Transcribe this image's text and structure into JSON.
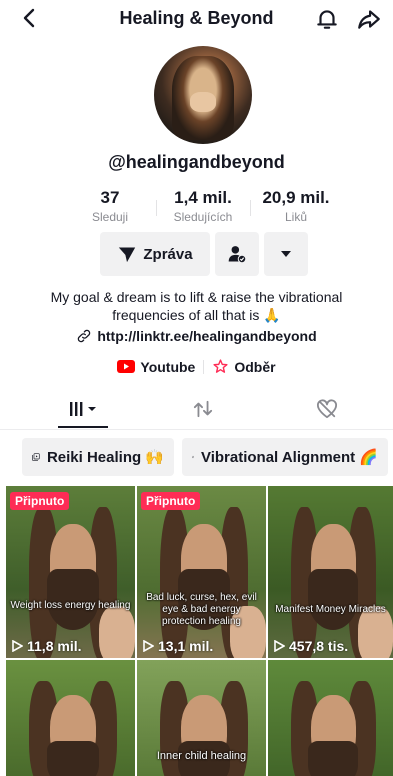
{
  "header": {
    "title": "Healing & Beyond"
  },
  "profile": {
    "handle": "@healingandbeyond",
    "stats": [
      {
        "value": "37",
        "label": "Sleduji"
      },
      {
        "value": "1,4 mil.",
        "label": "Sledujících"
      },
      {
        "value": "20,9 mil.",
        "label": "Liků"
      }
    ],
    "message_button": "Zpráva",
    "bio": "My goal & dream is to lift & raise the vibrational frequencies of all that is 🙏",
    "link": "http://linktr.ee/healingandbeyond",
    "socials": [
      {
        "label": "Youtube",
        "icon": "youtube-icon"
      },
      {
        "label": "Odběr",
        "icon": "subscription-icon"
      }
    ]
  },
  "tabs": [
    {
      "name": "videos",
      "icon": "grid-icon",
      "selected": true
    },
    {
      "name": "reposts",
      "icon": "repost-icon"
    },
    {
      "name": "liked",
      "icon": "liked-hidden-icon"
    }
  ],
  "playlists": [
    {
      "label": "Reiki Healing 🙌"
    },
    {
      "label": "Vibrational Alignment 🌈"
    }
  ],
  "videos": [
    {
      "pinned_label": "Připnuto",
      "caption": "Weight loss energy healing",
      "views": "11,8 mil."
    },
    {
      "pinned_label": "Připnuto",
      "caption": "Bad luck, curse, hex, evil eye & bad energy protection healing",
      "views": "13,1 mil."
    },
    {
      "pinned_label": "",
      "caption": "Manifest Money Miracles",
      "views": "457,8 tis."
    },
    {
      "pinned_label": "",
      "caption": "",
      "views": ""
    },
    {
      "pinned_label": "",
      "caption": "Inner child healing",
      "views": ""
    },
    {
      "pinned_label": "",
      "caption": "",
      "views": ""
    }
  ],
  "colors": {
    "accent": "#fe2c55",
    "youtube": "#ff0000",
    "button_bg": "#f1f1f2"
  }
}
